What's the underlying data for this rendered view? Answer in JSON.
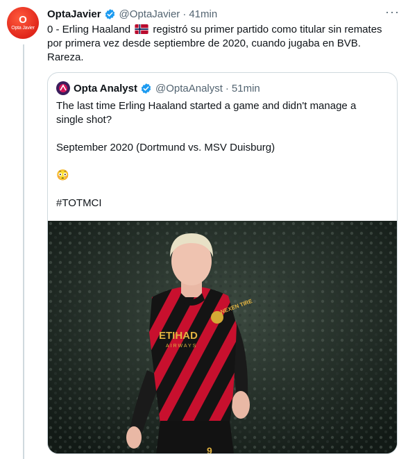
{
  "tweet": {
    "author_name": "OptaJavier",
    "handle": "@OptaJavier",
    "separator": "·",
    "time": "41min",
    "avatar_text": "Opta Javier",
    "text_line1_a": "0 - Erling Haaland",
    "text_line1_b": "registró su primer partido como titular sin remates",
    "text_line2": "por primera vez desde septiembre de 2020, cuando jugaba en BVB.",
    "text_line3": "Rareza.",
    "more_icon": "more-horizontal-icon",
    "verified_icon": "verified-badge-icon",
    "flag_icon": "norway-flag-icon"
  },
  "quoted_tweet": {
    "author_name": "Opta Analyst",
    "handle": "@OptaAnalyst",
    "separator": "·",
    "time": "51min",
    "line1": "The last time Erling Haaland started a game and didn't manage a",
    "line2": "single shot?",
    "line3": "September 2020 (Dortmund vs. MSV Duisburg)",
    "line4": "😳",
    "line5": "#TOTMCI",
    "photo_icon": "player-photo",
    "shirt_sponsor": "ETIHAD",
    "shirt_sponsor_sub": "AIRWAYS",
    "sleeve_text": "NEXEN TIRE",
    "shirt_number": "9"
  },
  "colors": {
    "text": "#0f1419",
    "muted": "#536471",
    "verified": "#1d9bf0",
    "border": "#cfd9de",
    "avatar_red": "#e0261b"
  }
}
